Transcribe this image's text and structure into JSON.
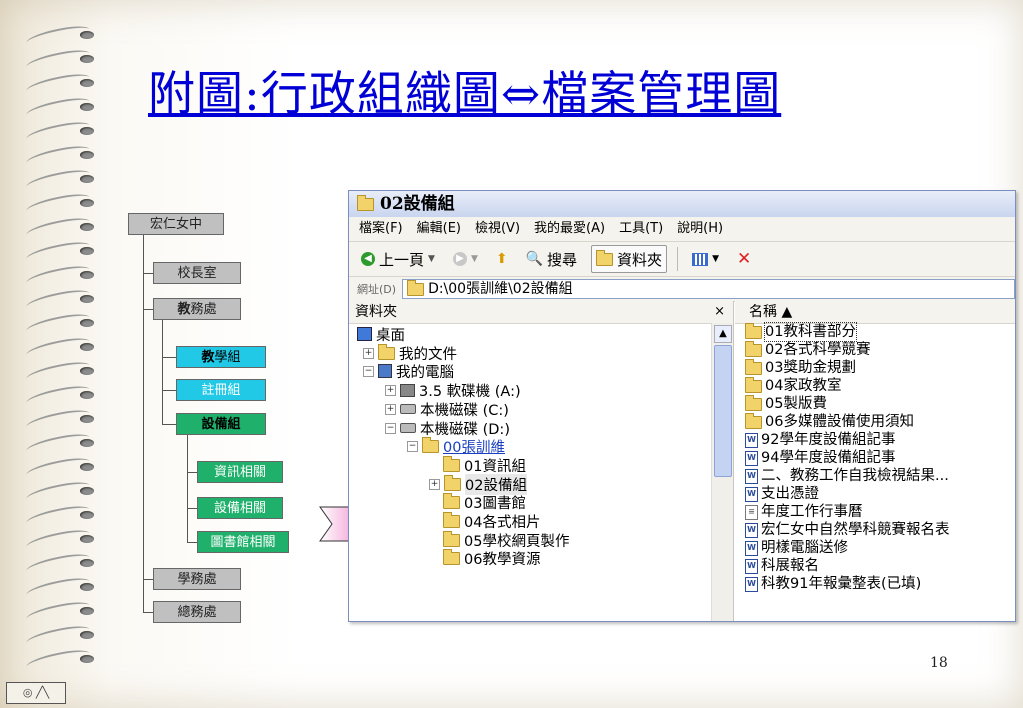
{
  "title": "附圖:行政組織圖⇔檔案管理圖",
  "page_number": "18",
  "corner_control": "◎ ╱╲",
  "org_chart": {
    "root": "宏仁女中",
    "principal": "校長室",
    "academic_bold": "教",
    "academic_rest": "務處",
    "teaching_bold": "教",
    "teaching_rest": "學組",
    "registry": "註冊組",
    "equipment": "設備組",
    "info": "資訊相關",
    "equipment_related": "設備相關",
    "library": "圖書館相關",
    "student_affairs": "學務處",
    "general_affairs": "總務處"
  },
  "explorer": {
    "window_title": "02設備組",
    "menu": [
      "檔案(F)",
      "編輯(E)",
      "檢視(V)",
      "我的最愛(A)",
      "工具(T)",
      "說明(H)"
    ],
    "toolbar": {
      "back": "上一頁",
      "search": "搜尋",
      "folders": "資料夾"
    },
    "address_label": "網址(D)",
    "address_value": "D:\\00張訓維\\02設備組",
    "tree_header": "資料夾",
    "tree_close": "×",
    "tree": [
      {
        "label": "桌面"
      },
      {
        "label": "我的文件"
      },
      {
        "label": "我的電腦"
      },
      {
        "label": "3.5 軟碟機 (A:)"
      },
      {
        "label": "本機磁碟 (C:)"
      },
      {
        "label": "本機磁碟 (D:)"
      },
      {
        "label": "00張訓維"
      },
      {
        "label": "01資訊組"
      },
      {
        "label": "02設備組"
      },
      {
        "label": "03圖書館"
      },
      {
        "label": "04各式相片"
      },
      {
        "label": "05學校網頁製作"
      },
      {
        "label": "06教學資源"
      }
    ],
    "list_header": "名稱 ▲",
    "files": [
      {
        "label": "01教科書部分"
      },
      {
        "label": "02各式科學競賽"
      },
      {
        "label": "03獎助金規劃"
      },
      {
        "label": "04家政教室"
      },
      {
        "label": "05製版費"
      },
      {
        "label": "06多媒體設備使用須知"
      },
      {
        "label": "92學年度設備組記事"
      },
      {
        "label": "94學年度設備組記事"
      },
      {
        "label": "二、教務工作自我檢視結果..."
      },
      {
        "label": "支出憑證"
      },
      {
        "label": "年度工作行事曆"
      },
      {
        "label": "宏仁女中自然學科競賽報名表"
      },
      {
        "label": "明樣電腦送修"
      },
      {
        "label": "科展報名"
      },
      {
        "label": "科教91年報彙整表(已填)"
      }
    ]
  }
}
